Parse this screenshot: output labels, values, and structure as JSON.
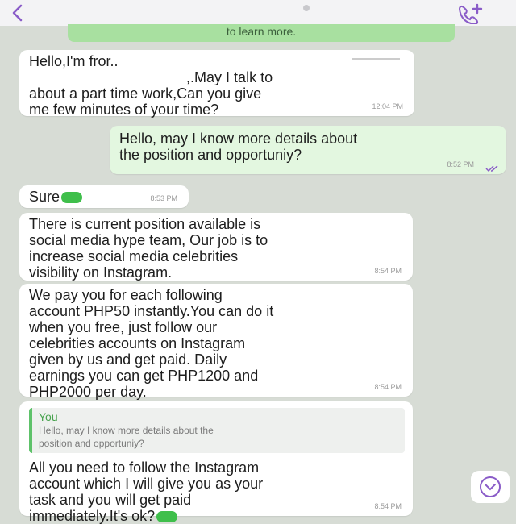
{
  "banner": {
    "text": "to learn more."
  },
  "messages": [
    {
      "direction": "in",
      "text": "Hello,I'm fror..\n                                       ,.May I talk to\nabout a part time work,Can you give\nme few minutes of your time?",
      "time": "12:04 PM"
    },
    {
      "direction": "out",
      "text": "Hello, may I know more details about\nthe position and opportuniy?",
      "time": "8:52 PM"
    },
    {
      "direction": "in",
      "text": "Sure",
      "time": "8:53 PM"
    },
    {
      "direction": "in",
      "text": "There is current position available is\nsocial media hype team, Our job is to\nincrease social media celebrities\nvisibility on Instagram.",
      "time": "8:54 PM"
    },
    {
      "direction": "in",
      "text": "We pay you for each following\naccount PHP50 instantly.You can do it\nwhen you free, just follow our\ncelebrities accounts on Instagram\ngiven by us and get paid. Daily\nearnings you can get PHP1200 and\nPHP2000 per day.",
      "time": "8:54 PM"
    },
    {
      "direction": "in",
      "quote": {
        "name": "You",
        "text": "Hello, may I know more details about the\nposition and opportuniy?"
      },
      "text": "All you need to follow the Instagram\naccount which I will give you as your\ntask and you will get paid\nimmediately.It's ok?",
      "time": "8:54 PM"
    }
  ],
  "icons": {
    "back": "chevron-left-icon",
    "call": "video-call-icon",
    "scroll_down": "chevron-down-icon"
  },
  "colors": {
    "accent": "#8a5cc8",
    "incoming": "#ffffff",
    "outgoing": "#e3f7e0",
    "background": "#d7dcd5",
    "banner": "#a8e0a0",
    "emoji": "#3fbf4b"
  }
}
